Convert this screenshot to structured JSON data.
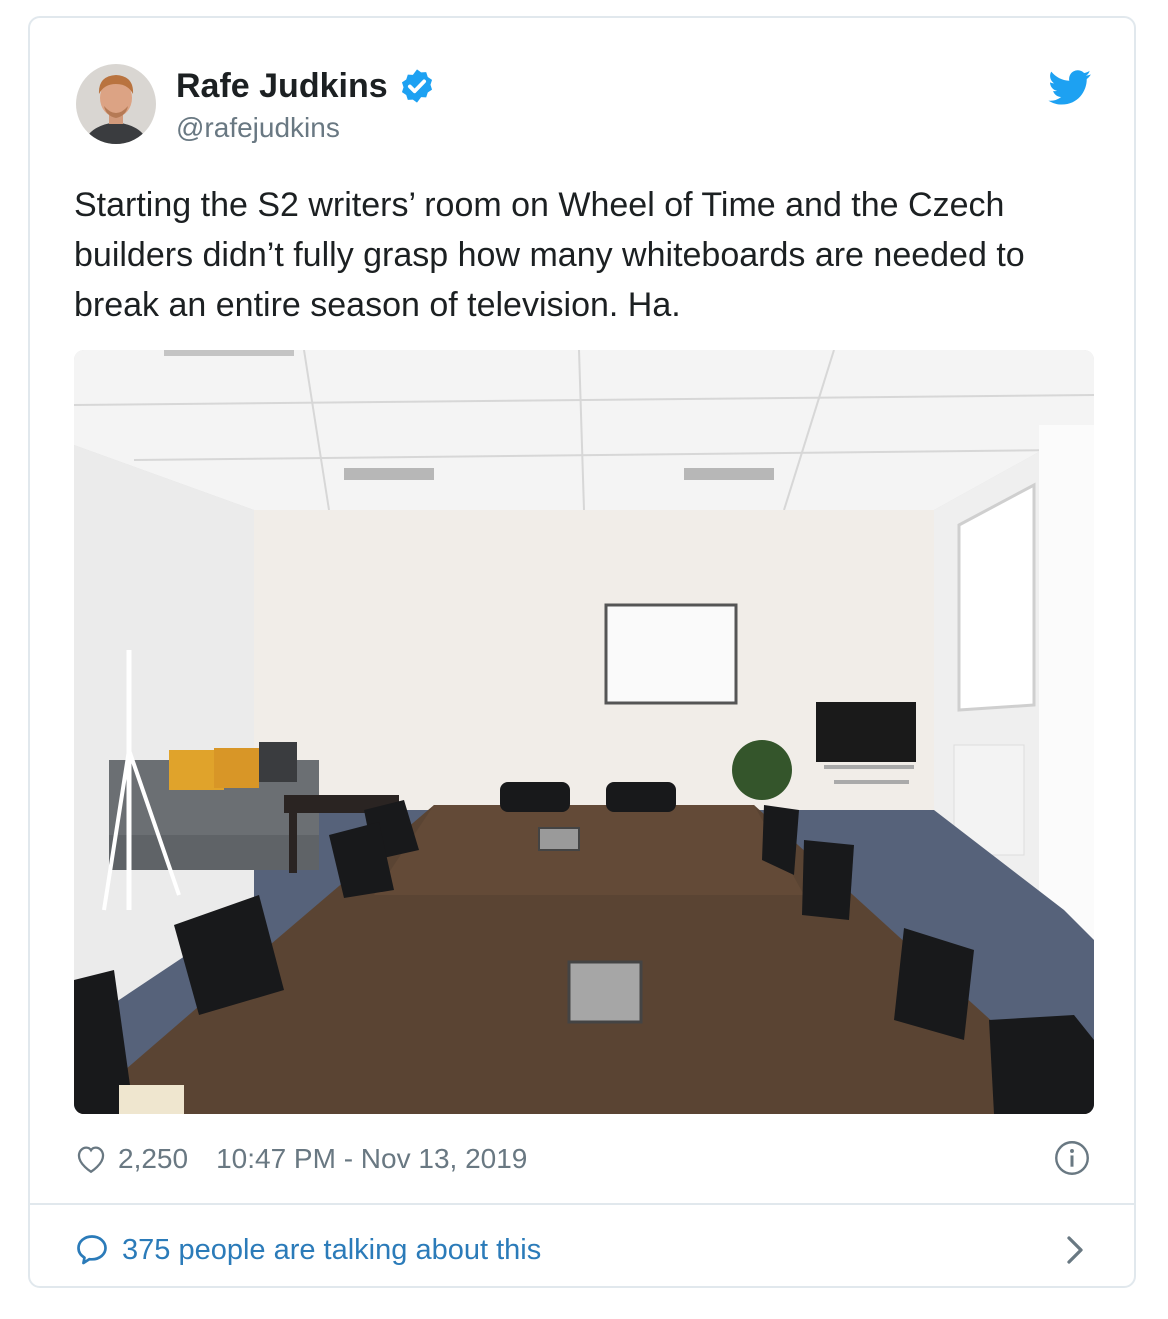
{
  "author": {
    "name": "Rafe Judkins",
    "handle": "@rafejudkins",
    "verified_icon": "verified-badge-icon"
  },
  "tweet": {
    "text": "Starting the S2 writers’ room on Wheel of Time and the Czech builders didn’t fully grasp how many whiteboards are needed to break an entire season of television.  Ha.",
    "likes": "2,250",
    "timestamp": "10:47 PM - Nov 13, 2019"
  },
  "footer": {
    "talking": "375 people are talking about this"
  },
  "icons": {
    "brand": "twitter-bird-icon",
    "like": "heart-icon",
    "info": "info-icon",
    "reply": "speech-bubble-icon",
    "more": "chevron-right-icon"
  },
  "colors": {
    "brand": "#1da1f2",
    "link": "#2b7bb9",
    "muted": "#697882",
    "border": "#e1e8ed"
  }
}
